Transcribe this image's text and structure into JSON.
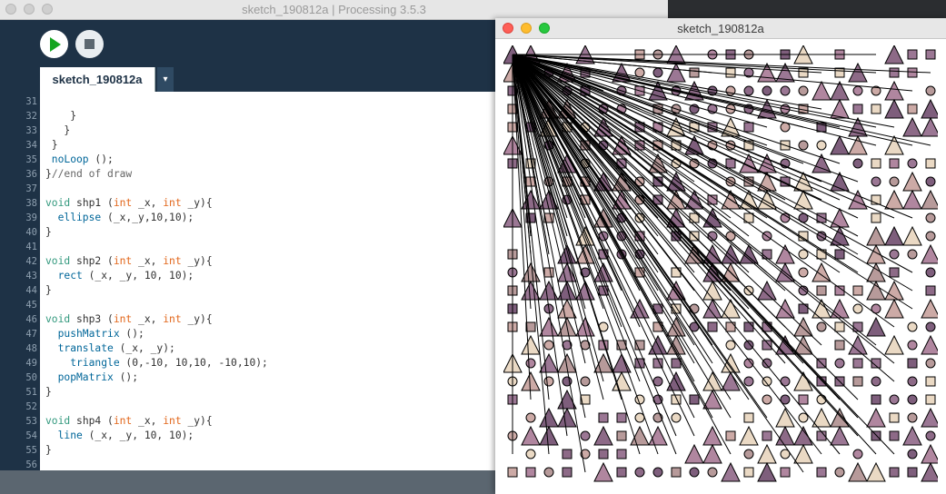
{
  "ide": {
    "title": "sketch_190812a | Processing 3.5.3",
    "tab_label": "sketch_190812a",
    "tab_menu_glyph": "▾",
    "icons": {
      "run": "play-icon",
      "stop": "stop-icon"
    },
    "code_lines": [
      {
        "n": "31",
        "segs": []
      },
      {
        "n": "32",
        "segs": [
          [
            "p",
            "    }"
          ]
        ]
      },
      {
        "n": "33",
        "segs": [
          [
            "p",
            "   }"
          ]
        ]
      },
      {
        "n": "34",
        "segs": [
          [
            "p",
            " }"
          ]
        ]
      },
      {
        "n": "35",
        "segs": [
          [
            "f",
            " noLoop"
          ],
          [
            "p",
            " ();"
          ]
        ]
      },
      {
        "n": "36",
        "segs": [
          [
            "p",
            "}"
          ],
          [
            "c",
            "//end of draw"
          ]
        ]
      },
      {
        "n": "37",
        "segs": []
      },
      {
        "n": "38",
        "segs": [
          [
            "k",
            "void"
          ],
          [
            "p",
            " shp1 ("
          ],
          [
            "t",
            "int"
          ],
          [
            "p",
            " _x, "
          ],
          [
            "t",
            "int"
          ],
          [
            "p",
            " _y){"
          ]
        ]
      },
      {
        "n": "39",
        "segs": [
          [
            "f",
            "  ellipse"
          ],
          [
            "p",
            " (_x,_y,10,10);"
          ]
        ]
      },
      {
        "n": "40",
        "segs": [
          [
            "p",
            "}"
          ]
        ]
      },
      {
        "n": "41",
        "segs": []
      },
      {
        "n": "42",
        "segs": [
          [
            "k",
            "void"
          ],
          [
            "p",
            " shp2 ("
          ],
          [
            "t",
            "int"
          ],
          [
            "p",
            " _x, "
          ],
          [
            "t",
            "int"
          ],
          [
            "p",
            " _y){"
          ]
        ]
      },
      {
        "n": "43",
        "segs": [
          [
            "f",
            "  rect"
          ],
          [
            "p",
            " (_x, _y, 10, 10);"
          ]
        ]
      },
      {
        "n": "44",
        "segs": [
          [
            "p",
            "}"
          ]
        ]
      },
      {
        "n": "45",
        "segs": []
      },
      {
        "n": "46",
        "segs": [
          [
            "k",
            "void"
          ],
          [
            "p",
            " shp3 ("
          ],
          [
            "t",
            "int"
          ],
          [
            "p",
            " _x, "
          ],
          [
            "t",
            "int"
          ],
          [
            "p",
            " _y){"
          ]
        ]
      },
      {
        "n": "47",
        "segs": [
          [
            "f",
            "  pushMatrix"
          ],
          [
            "p",
            " ();"
          ]
        ]
      },
      {
        "n": "48",
        "segs": [
          [
            "f",
            "  translate"
          ],
          [
            "p",
            " (_x, _y);"
          ]
        ]
      },
      {
        "n": "49",
        "segs": [
          [
            "f",
            "    triangle"
          ],
          [
            "p",
            " (0,-10, 10,10, -10,10);"
          ]
        ]
      },
      {
        "n": "50",
        "segs": [
          [
            "f",
            "  popMatrix"
          ],
          [
            "p",
            " ();"
          ]
        ]
      },
      {
        "n": "51",
        "segs": [
          [
            "p",
            "}"
          ]
        ]
      },
      {
        "n": "52",
        "segs": []
      },
      {
        "n": "53",
        "segs": [
          [
            "k",
            "void"
          ],
          [
            "p",
            " shp4 ("
          ],
          [
            "t",
            "int"
          ],
          [
            "p",
            " _x, "
          ],
          [
            "t",
            "int"
          ],
          [
            "p",
            " _y){"
          ]
        ]
      },
      {
        "n": "54",
        "segs": [
          [
            "f",
            "  line"
          ],
          [
            "p",
            " (_x, _y, 10, 10);"
          ]
        ]
      },
      {
        "n": "55",
        "segs": [
          [
            "p",
            "}"
          ]
        ]
      },
      {
        "n": "56",
        "segs": []
      }
    ]
  },
  "sketch": {
    "title": "sketch_190812a",
    "palette": [
      "#9b7794",
      "#8d6a87",
      "#b79a9a",
      "#ccaaa6",
      "#ead9c4",
      "#b0869f",
      "#7e5e7c"
    ],
    "line_origin": [
      10,
      10
    ],
    "shape_seed": 190812
  },
  "colors": {
    "toolbar_bg": "#1e3246",
    "run_green": "#14a520",
    "close_red": "#fe5f57",
    "minimize_yellow": "#febc2e",
    "zoom_green": "#28c840"
  }
}
